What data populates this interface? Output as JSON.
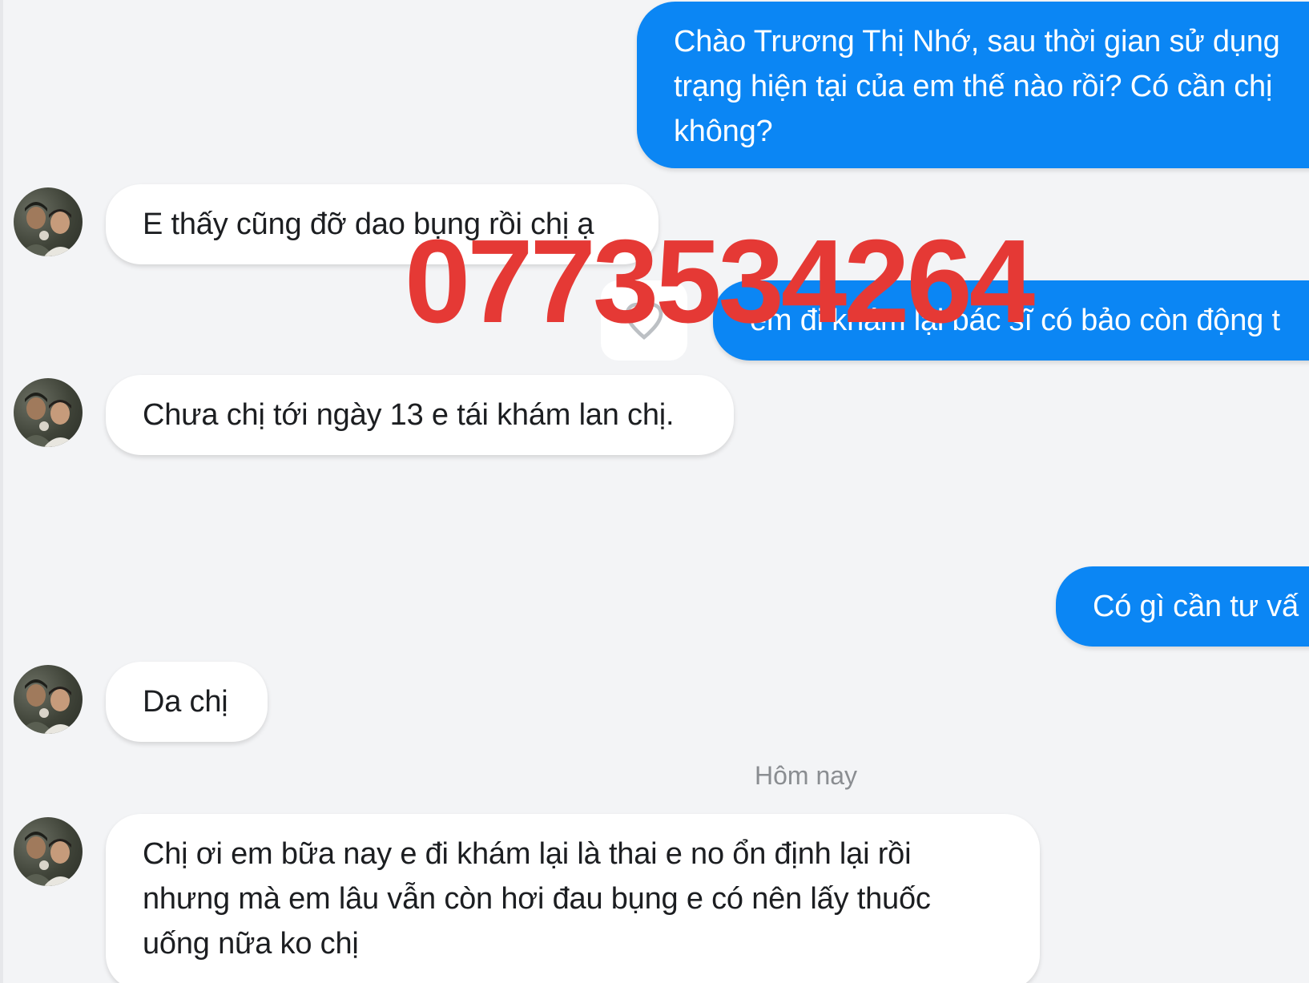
{
  "conversation": {
    "messages": [
      {
        "side": "out",
        "text": "Chào Trương Thị Nhớ, sau thời gian sử dụng trạng hiện tại của em thế nào rồi? Có cần chị không?"
      },
      {
        "side": "in",
        "text": "E thấy cũng đỡ dao bụng rồi chị ạ"
      },
      {
        "side": "out",
        "text": "em đi khám lại bác sĩ có bảo còn động t"
      },
      {
        "side": "in",
        "text": "Chưa chị tới ngày 13 e tái khám lan chị."
      },
      {
        "side": "out",
        "text": "Có gì cần tư vấ"
      },
      {
        "side": "in",
        "text": "Da chị"
      },
      {
        "side": "in",
        "text": "Chị ơi em bữa nay e đi khám lại là thai e no ổn định lại rồi nhưng mà em lâu vẫn còn hơi đau bụng e có nên lấy thuốc uống nữa ko chị"
      }
    ],
    "day_separator": "Hôm nay"
  },
  "watermark": {
    "text": "0773534264",
    "color": "#e53935"
  },
  "icons": {
    "reaction": "heart-outline-icon",
    "avatar": "contact-avatar"
  },
  "colors": {
    "outgoing_bubble": "#0b86f4",
    "incoming_bubble": "#ffffff",
    "background": "#f3f4f6"
  }
}
